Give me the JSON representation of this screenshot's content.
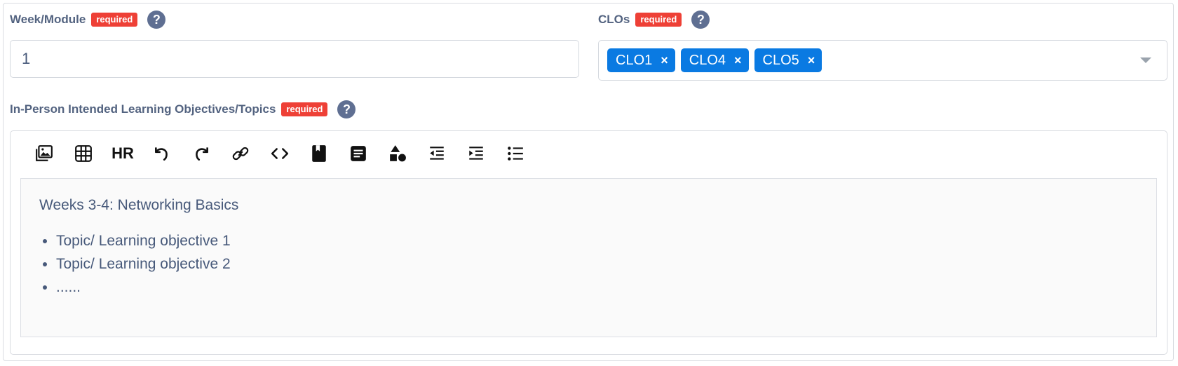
{
  "week_module": {
    "label": "Week/Module",
    "badge": "required",
    "help": "?",
    "value": "1"
  },
  "clos": {
    "label": "CLOs",
    "badge": "required",
    "help": "?",
    "tags": [
      "CLO1",
      "CLO4",
      "CLO5"
    ],
    "remove_glyph": "×"
  },
  "objectives": {
    "label": "In-Person Intended Learning Objectives/Topics",
    "badge": "required",
    "help": "?"
  },
  "toolbar": {
    "hr_label": "HR",
    "buttons": [
      "image-icon",
      "table-icon",
      "hr-button",
      "undo-icon",
      "redo-icon",
      "link-icon",
      "code-icon",
      "bookmark-icon",
      "document-icon",
      "shapes-icon",
      "outdent-icon",
      "indent-icon",
      "bullet-list-icon"
    ]
  },
  "editor_content": {
    "heading": "Weeks 3-4: Networking Basics",
    "items": [
      "Topic/ Learning objective 1",
      "Topic/ Learning objective 2",
      "......"
    ]
  },
  "colors": {
    "badge": "#ee4036",
    "tag": "#0a7ae2",
    "help": "#5f6f92",
    "text": "#47597a"
  }
}
